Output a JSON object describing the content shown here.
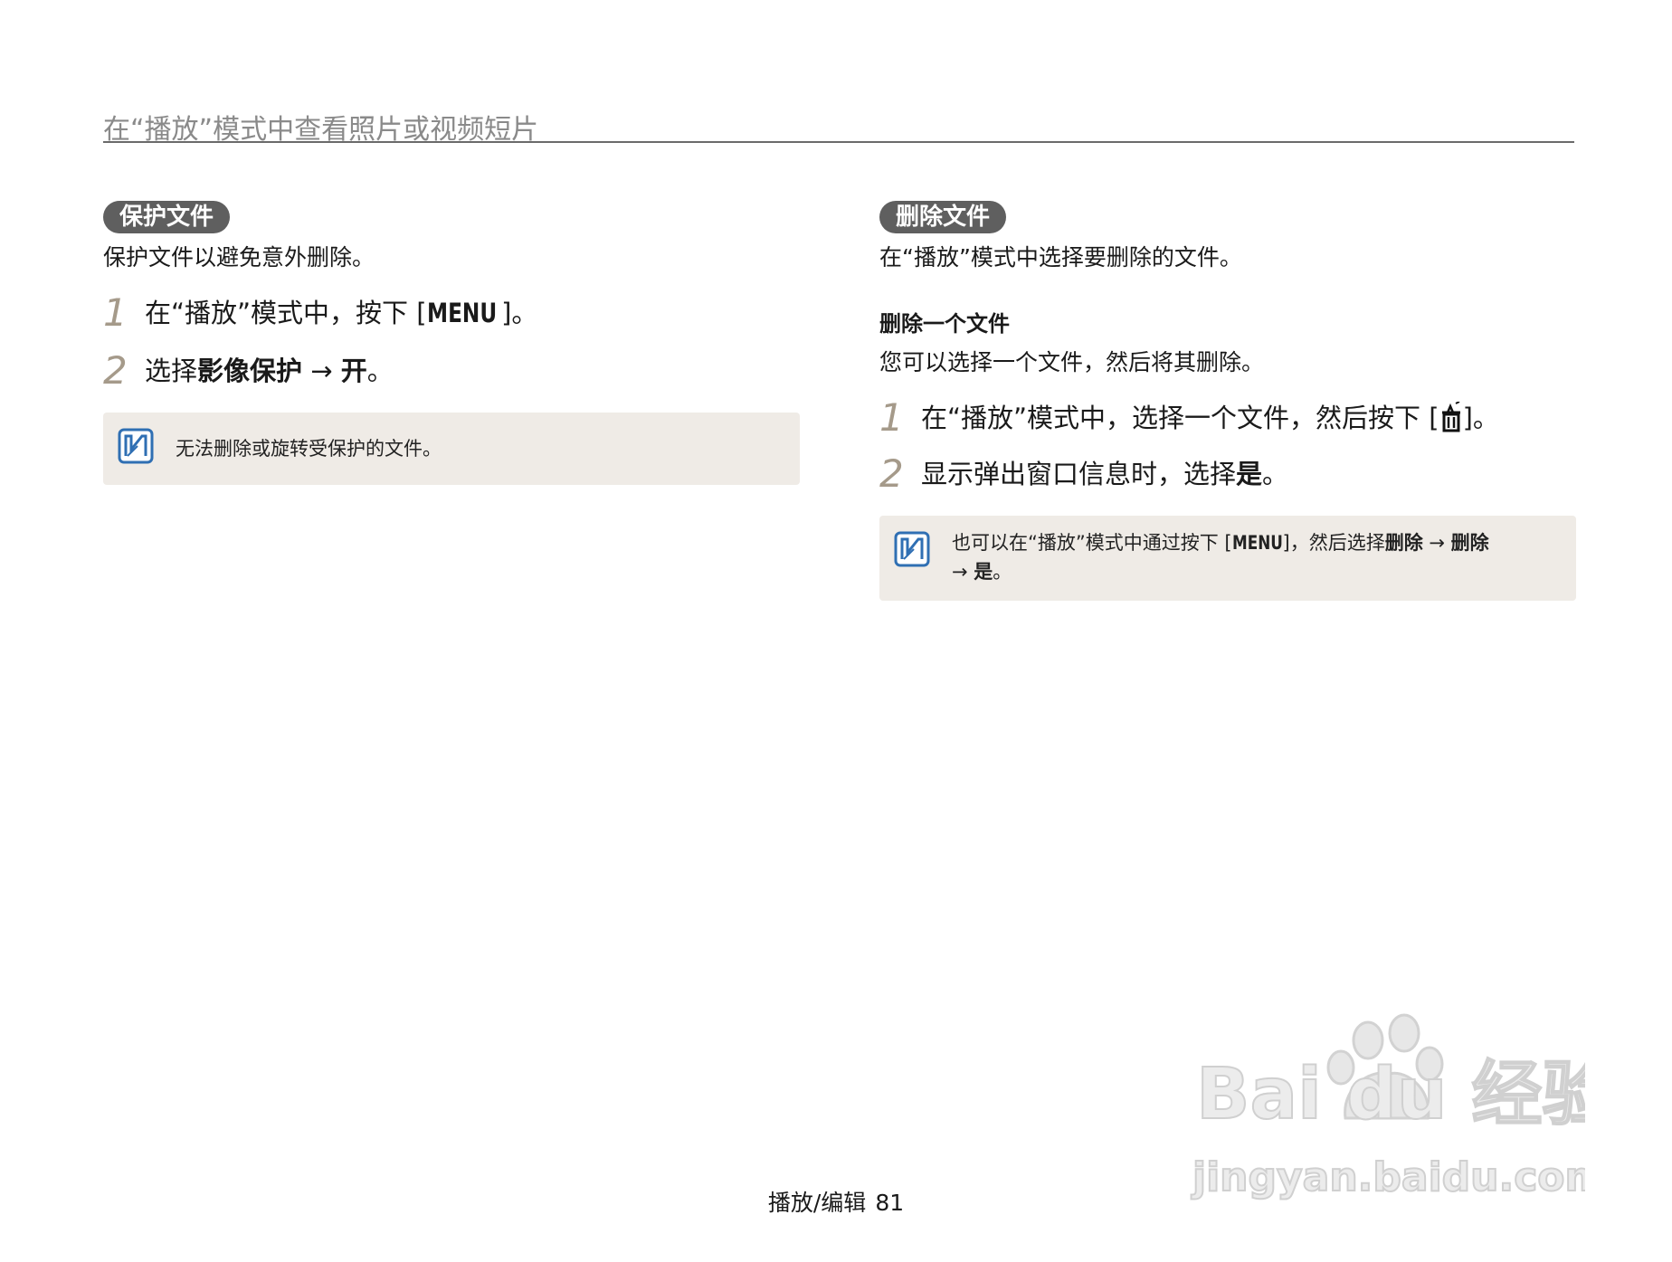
{
  "header": {
    "title": "在“播放”模式中查看照片或视频短片"
  },
  "left": {
    "pill": "保护文件",
    "intro": "保护文件以避免意外删除。",
    "steps": [
      {
        "num": "1",
        "pre": "在“播放”模式中，按下 [",
        "key": "MENU",
        "post": "]。"
      },
      {
        "num": "2",
        "pre": "选择",
        "bold1": "影像保护",
        "arrow": " → ",
        "bold2": "开",
        "post": "。"
      }
    ],
    "note": "无法删除或旋转受保护的文件。"
  },
  "right": {
    "pill": "删除文件",
    "intro": "在“播放”模式中选择要删除的文件。",
    "subhead": "删除一个文件",
    "sub_desc": "您可以选择一个文件，然后将其删除。",
    "steps": [
      {
        "num": "1",
        "pre": "在“播放”模式中，选择一个文件，然后按下 [",
        "icon": "trash-icon",
        "post": "]。"
      },
      {
        "num": "2",
        "pre": "显示弹出窗口信息时，选择",
        "bold": "是",
        "post": "。"
      }
    ],
    "note": {
      "pre": "也可以在“播放”模式中通过按下 [",
      "key": "MENU",
      "mid": "]，然后选择",
      "bold1": "删除",
      "arrow1": " → ",
      "bold2": "删除",
      "arrow2": "→ ",
      "bold3": "是",
      "post": "。"
    }
  },
  "footer": {
    "section": "播放/编辑",
    "page": "81"
  },
  "watermark": {
    "brand": "Bai du 经验",
    "url": "jingyan.baidu.com"
  },
  "colors": {
    "pill_bg": "#5f5f5f",
    "note_bg": "#efebe6",
    "step_num": "#a59a8a",
    "note_icon": "#2f6fb3"
  }
}
